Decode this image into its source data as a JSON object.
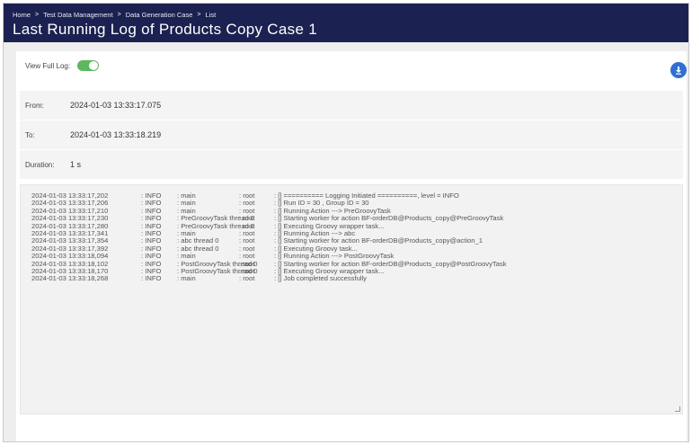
{
  "breadcrumb": {
    "items": [
      "Home",
      "Test Data Management",
      "Data Generation Case",
      "List"
    ],
    "separator": ">"
  },
  "page": {
    "title": "Last Running Log of Products Copy Case 1"
  },
  "toolbar": {
    "view_full_log_label": "View Full Log:",
    "view_full_log_on": true,
    "download_icon": "download-icon"
  },
  "info": {
    "from_label": "From:",
    "from_value": "2024-01-03 13:33:17.075",
    "to_label": "To:",
    "to_value": "2024-01-03 13:33:18.219",
    "duration_label": "Duration:",
    "duration_value": "1 s"
  },
  "log": [
    {
      "ts": "2024-01-03 13:33:17,202",
      "level": ": INFO",
      "thread": ": main",
      "user": ": root",
      "msg": ": [] ========== Logging Initiated ==========, level = INFO"
    },
    {
      "ts": "2024-01-03 13:33:17,206",
      "level": ": INFO",
      "thread": ": main",
      "user": ": root",
      "msg": ": [] Run ID = 30 , Group ID = 30"
    },
    {
      "ts": "2024-01-03 13:33:17,210",
      "level": ": INFO",
      "thread": ": main",
      "user": ": root",
      "msg": ": [] Running Action ---> PreGroovyTask"
    },
    {
      "ts": "2024-01-03 13:33:17,230",
      "level": ": INFO",
      "thread": ": PreGroovyTask thread 0",
      "user": ": root",
      "msg": ": [] Starting worker for action BF-orderDB@Products_copy@PreGroovyTask"
    },
    {
      "ts": "2024-01-03 13:33:17,280",
      "level": ": INFO",
      "thread": ": PreGroovyTask thread 0",
      "user": ": root",
      "msg": ": [] Executing Groovy wrapper task..."
    },
    {
      "ts": "2024-01-03 13:33:17,341",
      "level": ": INFO",
      "thread": ": main",
      "user": ": root",
      "msg": ": [] Running Action ---> abc"
    },
    {
      "ts": "2024-01-03 13:33:17,354",
      "level": ": INFO",
      "thread": ": abc thread 0",
      "user": ": root",
      "msg": ": [] Starting worker for action BF-orderDB@Products_copy@action_1"
    },
    {
      "ts": "2024-01-03 13:33:17,392",
      "level": ": INFO",
      "thread": ": abc thread 0",
      "user": ": root",
      "msg": ": [] Executing Groovy task..."
    },
    {
      "ts": "2024-01-03 13:33:18,094",
      "level": ": INFO",
      "thread": ": main",
      "user": ": root",
      "msg": ": [] Running Action ---> PostGroovyTask"
    },
    {
      "ts": "2024-01-03 13:33:18,102",
      "level": ": INFO",
      "thread": ": PostGroovyTask thread 0",
      "user": ": root",
      "msg": ": [] Starting worker for action BF-orderDB@Products_copy@PostGroovyTask"
    },
    {
      "ts": "2024-01-03 13:33:18,170",
      "level": ": INFO",
      "thread": ": PostGroovyTask thread 0",
      "user": ": root",
      "msg": ": [] Executing Groovy wrapper task..."
    },
    {
      "ts": "2024-01-03 13:33:18,268",
      "level": ": INFO",
      "thread": ": main",
      "user": ": root",
      "msg": ": [] Job completed successfully"
    }
  ],
  "colors": {
    "header_bg": "#1b2150",
    "toggle_on": "#5cb85c",
    "download_button": "#2f6fd6"
  }
}
